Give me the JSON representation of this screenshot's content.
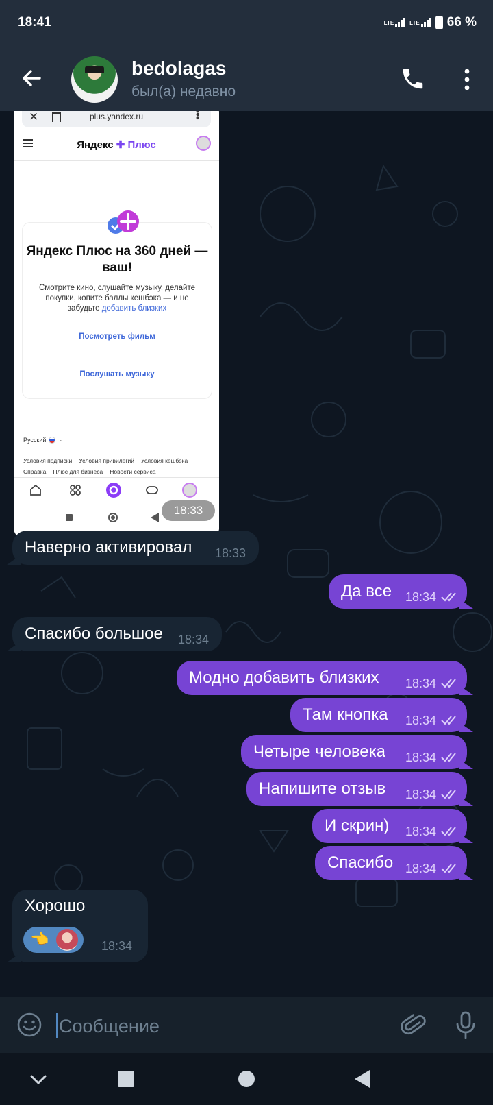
{
  "status_bar": {
    "time": "18:41",
    "network1": "LTE",
    "network2": "LTE",
    "battery": "66 %"
  },
  "header": {
    "name": "bedolagas",
    "status": "был(а) недавно"
  },
  "image_message": {
    "time": "18:33",
    "screenshot": {
      "url": "plus.yandex.ru",
      "logo_brand": "Яндекс",
      "logo_product": "Плюс",
      "card_title": "Яндекс Плюс на 360 дней — ваш!",
      "card_text": "Смотрите кино, слушайте музыку, делайте покупки, копите баллы кешбэка — и не забудьте",
      "card_text_link": "добавить близких",
      "link1": "Посмотреть фильм",
      "link2": "Послушать музыку",
      "language": "Русский",
      "footer_links": [
        "Условия подписки",
        "Условия привилегий",
        "Условия кешбэка",
        "Справка",
        "Плюс для бизнеса",
        "Новости сервиса"
      ]
    }
  },
  "messages": [
    {
      "dir": "in",
      "text": "Наверно активировал",
      "time": "18:33"
    },
    {
      "dir": "out",
      "text": "Да все",
      "time": "18:34"
    },
    {
      "dir": "in",
      "text": "Спасибо большое",
      "time": "18:34"
    },
    {
      "dir": "out",
      "text": "Модно добавить близких",
      "time": "18:34"
    },
    {
      "dir": "out",
      "text": "Там кнопка",
      "time": "18:34"
    },
    {
      "dir": "out",
      "text": "Четыре человека",
      "time": "18:34"
    },
    {
      "dir": "out",
      "text": "Напишите отзыв",
      "time": "18:34"
    },
    {
      "dir": "out",
      "text": "И скрин)",
      "time": "18:34"
    },
    {
      "dir": "out",
      "text": "Спасибо",
      "time": "18:34"
    }
  ],
  "reaction_message": {
    "text": "Хорошо",
    "time": "18:34",
    "reaction_emoji": "👈"
  },
  "input": {
    "placeholder": "Сообщение"
  },
  "colors": {
    "outgoing_bubble": "#7744d4",
    "incoming_bubble": "#182533",
    "chat_bg": "#0e1621",
    "accent": "#5288c1"
  }
}
